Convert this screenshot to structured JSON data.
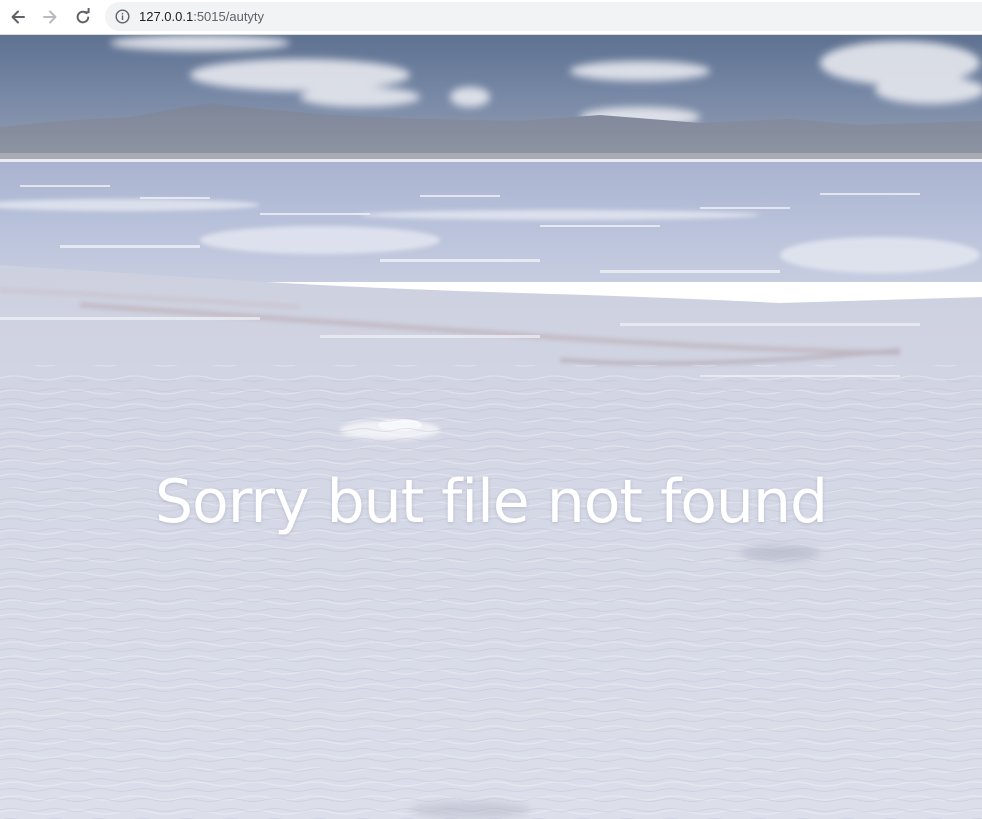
{
  "browser": {
    "url_host": "127.0.0.1",
    "url_rest": ":5015/autyty",
    "icons": {
      "back": "arrow-left-icon",
      "forward": "arrow-right-icon",
      "reload": "reload-icon",
      "site_info": "info-circle-icon"
    }
  },
  "page": {
    "message": "Sorry but file not found",
    "background": "salt-flat-photo"
  },
  "colors": {
    "text": "#ffffff",
    "omnibox": "#f1f3f4",
    "sky": "#6d7f9e",
    "salt": "#d8dbe7"
  }
}
